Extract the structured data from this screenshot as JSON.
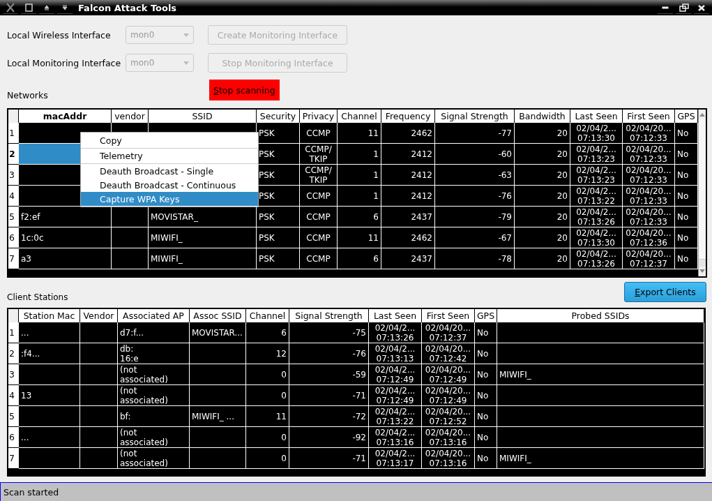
{
  "window": {
    "title": "Falcon Attack Tools"
  },
  "form": [
    {
      "label": "Local Wireless Interface",
      "combo": {
        "value": "mon0",
        "disabled": true
      },
      "button": {
        "label": "Create Monitoring Interface",
        "disabled": true
      }
    },
    {
      "label": "Local Monitoring Interface",
      "combo": {
        "value": "mon0",
        "disabled": true
      },
      "button": {
        "label": "Stop Monitoring Interface",
        "disabled": true
      }
    }
  ],
  "stop_button": {
    "label": "Stop scanning"
  },
  "networks": {
    "label": "Networks",
    "columns": [
      {
        "label": "macAddr",
        "kind": "text",
        "sorted": true
      },
      {
        "label": "vendor",
        "kind": "text",
        "sorted": false
      },
      {
        "label": "SSID",
        "kind": "text",
        "sorted": false
      },
      {
        "label": "Security",
        "kind": "text",
        "sorted": false
      },
      {
        "label": "Privacy",
        "kind": "center",
        "sorted": false
      },
      {
        "label": "Channel",
        "kind": "number",
        "sorted": false
      },
      {
        "label": "Frequency",
        "kind": "number",
        "sorted": false
      },
      {
        "label": "Signal Strength",
        "kind": "number",
        "sorted": false
      },
      {
        "label": "Bandwidth",
        "kind": "number",
        "sorted": false
      },
      {
        "label": "Last Seen",
        "kind": "center",
        "sorted": false
      },
      {
        "label": "First Seen",
        "kind": "center",
        "sorted": false
      },
      {
        "label": "GPS",
        "kind": "text",
        "sorted": false
      }
    ],
    "rows": [
      {
        "number": "1",
        "selected": false,
        "cells": [
          "",
          "",
          "",
          "PSK",
          "CCMP",
          "11",
          "2462",
          "-77",
          "20",
          "02/04/2...\n07:13:30",
          "02/04/20...\n07:12:33",
          "No"
        ]
      },
      {
        "number": "2",
        "selected": true,
        "cells": [
          "",
          "",
          "",
          "PSK",
          "CCMP/\nTKIP",
          "1",
          "2412",
          "-60",
          "20",
          "02/04/2...\n07:13:23",
          "02/04/20...\n07:12:33",
          "No"
        ]
      },
      {
        "number": "3",
        "selected": false,
        "cells": [
          "",
          "",
          "",
          "PSK",
          "CCMP/\nTKIP",
          "1",
          "2412",
          "-63",
          "20",
          "02/04/2...\n07:13:23",
          "02/04/20...\n07:12:33",
          "No"
        ]
      },
      {
        "number": "4",
        "selected": false,
        "cells": [
          "",
          "",
          "",
          "PSK",
          "CCMP",
          "1",
          "2412",
          "-76",
          "20",
          "02/04/2...\n07:13:22",
          "02/04/20...\n07:12:33",
          "No"
        ]
      },
      {
        "number": "5",
        "selected": false,
        "cells": [
          "f2:ef",
          "",
          "MOVISTAR_",
          "PSK",
          "CCMP",
          "6",
          "2437",
          "-79",
          "20",
          "02/04/2...\n07:13:26",
          "02/04/20...\n07:12:33",
          "No"
        ]
      },
      {
        "number": "6",
        "selected": false,
        "cells": [
          "1c:0c",
          "",
          "MIWIFI_",
          "PSK",
          "CCMP",
          "11",
          "2462",
          "-67",
          "20",
          "02/04/2...\n07:13:30",
          "02/04/20...\n07:12:36",
          "No"
        ]
      },
      {
        "number": "7",
        "selected": false,
        "cells": [
          "a3",
          "",
          "MIWIFI_",
          "PSK",
          "CCMP",
          "6",
          "2437",
          "-78",
          "20",
          "02/04/2...\n07:13:26",
          "02/04/20...\n07:12:37",
          "No"
        ]
      }
    ]
  },
  "context_menu": {
    "items": [
      {
        "label": "Copy",
        "selected": false,
        "separator_after": true
      },
      {
        "label": "Telemetry",
        "selected": false,
        "separator_after": true
      },
      {
        "label": "Deauth Broadcast - Single",
        "selected": false,
        "separator_after": false
      },
      {
        "label": "Deauth Broadcast - Continuous",
        "selected": false,
        "separator_after": false
      },
      {
        "label": "Capture WPA Keys",
        "selected": true,
        "separator_after": false
      }
    ]
  },
  "clients": {
    "label": "Client Stations",
    "export_button": {
      "label": "Export Clients"
    },
    "columns": [
      {
        "label": "Station Mac",
        "kind": "text",
        "sorted": false
      },
      {
        "label": "Vendor",
        "kind": "text",
        "sorted": false
      },
      {
        "label": "Associated AP",
        "kind": "text",
        "sorted": false
      },
      {
        "label": "Assoc SSID",
        "kind": "text",
        "sorted": false
      },
      {
        "label": "Channel",
        "kind": "number",
        "sorted": false
      },
      {
        "label": "Signal Strength",
        "kind": "number",
        "sorted": false
      },
      {
        "label": "Last Seen",
        "kind": "center",
        "sorted": false
      },
      {
        "label": "First Seen",
        "kind": "center",
        "sorted": false
      },
      {
        "label": "GPS",
        "kind": "text",
        "sorted": false
      },
      {
        "label": "Probed SSIDs",
        "kind": "text",
        "sorted": false
      }
    ],
    "rows": [
      {
        "number": "1",
        "selected": false,
        "cells": [
          "...",
          "",
          "d7:f...",
          "MOVISTAR...",
          "6",
          "-75",
          "02/04/2...\n07:13:26",
          "02/04/20...\n07:12:37",
          "No",
          ""
        ]
      },
      {
        "number": "2",
        "selected": false,
        "cells": [
          ":f4...",
          "",
          "db:\n16:e",
          "",
          "12",
          "-76",
          "02/04/2...\n07:13:13",
          "02/04/20...\n07:12:42",
          "No",
          ""
        ]
      },
      {
        "number": "3",
        "selected": false,
        "cells": [
          "",
          "",
          "(not\nassociated)",
          "",
          "0",
          "-59",
          "02/04/2...\n07:12:49",
          "02/04/20...\n07:12:49",
          "No",
          "MIWIFI_"
        ]
      },
      {
        "number": "4",
        "selected": false,
        "cells": [
          "13",
          "",
          "(not\nassociated)",
          "",
          "0",
          "-71",
          "02/04/2...\n07:12:49",
          "02/04/20...\n07:12:49",
          "No",
          ""
        ]
      },
      {
        "number": "5",
        "selected": false,
        "cells": [
          "",
          "",
          "bf:",
          "MIWIFI_    ...",
          "11",
          "-72",
          "02/04/2...\n07:13:22",
          "02/04/20...\n07:12:52",
          "No",
          ""
        ]
      },
      {
        "number": "6",
        "selected": false,
        "cells": [
          "...",
          "",
          "(not\nassociated)",
          "",
          "0",
          "-92",
          "02/04/2...\n07:13:16",
          "02/04/20...\n07:13:16",
          "No",
          ""
        ]
      },
      {
        "number": "7",
        "selected": false,
        "cells": [
          "",
          "",
          "(not\nassociated)",
          "",
          "0",
          "-71",
          "02/04/2...\n07:13:17",
          "02/04/20...\n07:13:16",
          "No",
          "MIWIFI_"
        ]
      }
    ]
  },
  "status_bar": {
    "text": "Scan started"
  }
}
